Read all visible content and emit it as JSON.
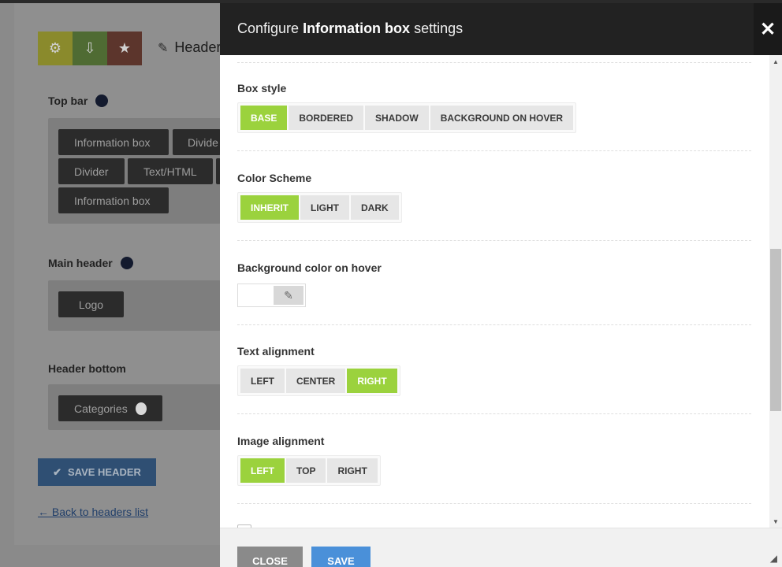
{
  "builder": {
    "header_title": "Header",
    "sections": {
      "top_bar": {
        "label": "Top bar",
        "chips": [
          "Information box",
          "Divide",
          "Divider",
          "Text/HTML",
          "Information box"
        ]
      },
      "main_header": {
        "label": "Main header",
        "chips": [
          "Logo"
        ]
      },
      "header_bottom": {
        "label": "Header bottom",
        "chips": [
          "Categories"
        ]
      }
    },
    "save_header_label": "SAVE HEADER",
    "back_link": "← Back to headers list"
  },
  "modal": {
    "title_prefix": "Configure ",
    "title_bold": "Information box",
    "title_suffix": " settings",
    "close_icon_glyph": "✕",
    "fields": {
      "box_style": {
        "label": "Box style",
        "options": [
          "BASE",
          "BORDERED",
          "SHADOW",
          "BACKGROUND ON HOVER"
        ],
        "selected": "BASE"
      },
      "color_scheme": {
        "label": "Color Scheme",
        "options": [
          "INHERIT",
          "LIGHT",
          "DARK"
        ],
        "selected": "INHERIT"
      },
      "bg_hover": {
        "label": "Background color on hover"
      },
      "text_alignment": {
        "label": "Text alignment",
        "options": [
          "LEFT",
          "CENTER",
          "RIGHT"
        ],
        "selected": "RIGHT"
      },
      "image_alignment": {
        "label": "Image alignment",
        "options": [
          "LEFT",
          "TOP",
          "RIGHT"
        ],
        "selected": "LEFT"
      }
    },
    "footer": {
      "close_label": "CLOSE",
      "save_label": "SAVE"
    }
  },
  "colors": {
    "accent_green": "#9bd23d",
    "save_blue": "#4a90d9",
    "header_dark": "#222222"
  }
}
